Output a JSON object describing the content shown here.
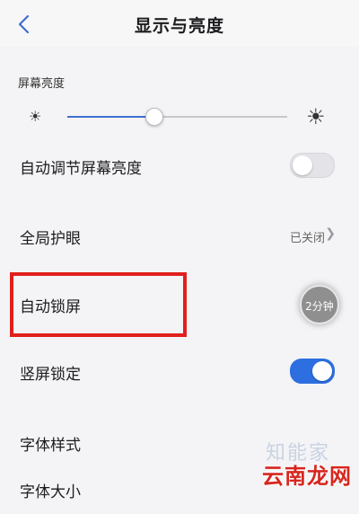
{
  "header": {
    "back_icon": "chevron-left-icon",
    "title": "显示与亮度"
  },
  "brightness": {
    "section_label": "屏幕亮度",
    "level": 0.39,
    "min_icon": "sun-small-icon",
    "max_icon": "sun-large-icon"
  },
  "rows": {
    "auto_brightness": {
      "label": "自动调节屏幕亮度",
      "on": false
    },
    "eye_care": {
      "label": "全局护眼",
      "value": "已关闭"
    },
    "auto_lock": {
      "label": "自动锁屏",
      "value": "2分钟"
    },
    "portrait_lock": {
      "label": "竖屏锁定",
      "on": true
    },
    "font_style": {
      "label": "字体样式"
    },
    "font_size": {
      "label": "字体大小"
    }
  },
  "watermark": {
    "main": "云南龙网",
    "faint": "知能家"
  },
  "colors": {
    "accent": "#2d6fe0",
    "highlight": "#e0201c"
  }
}
